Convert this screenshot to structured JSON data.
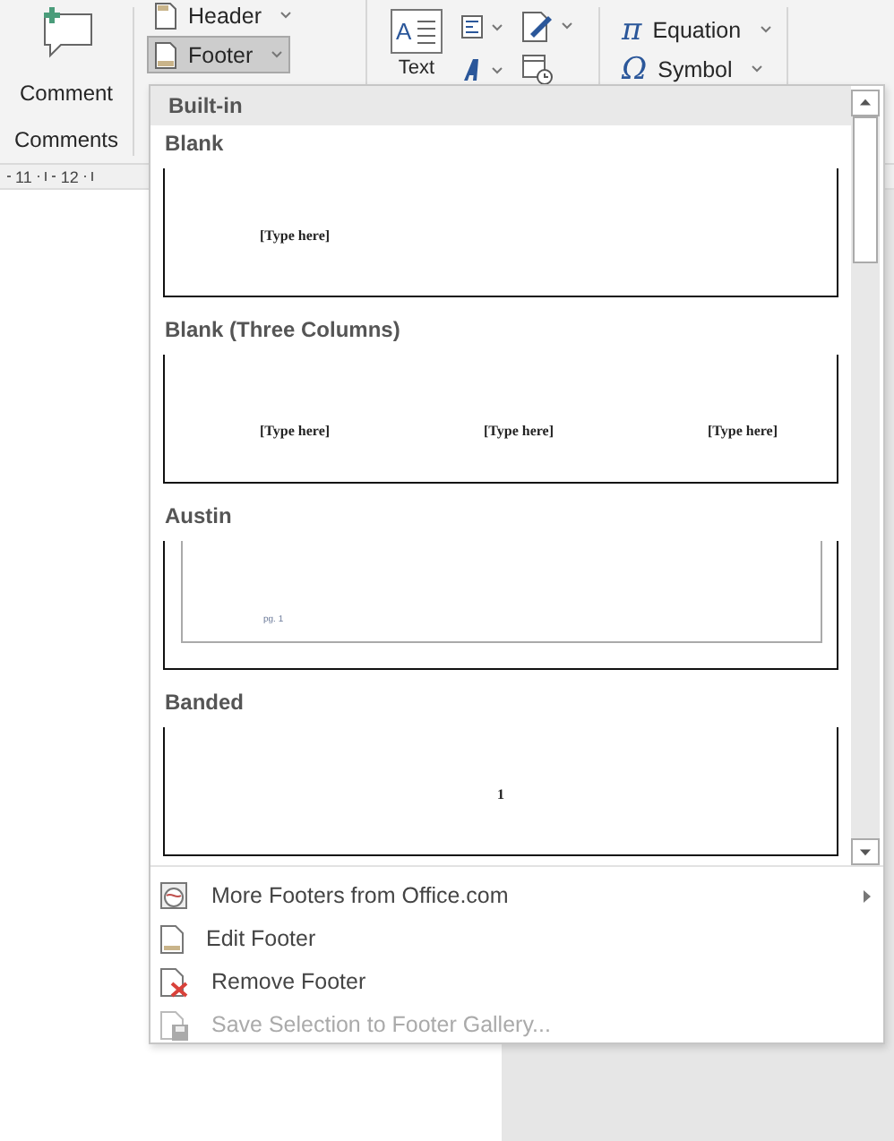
{
  "ribbon": {
    "comment_button": "Comment",
    "comments_group_label": "Comments",
    "header_footer": [
      {
        "label": "Header",
        "selected": false
      },
      {
        "label": "Footer",
        "selected": true
      }
    ],
    "text_button": "Text",
    "text_box_glyph": "A",
    "symbols": [
      {
        "symbol": "π",
        "label": "Equation"
      },
      {
        "symbol": "Ω",
        "label": "Symbol"
      }
    ]
  },
  "ruler": {
    "numbers": [
      "11",
      "12"
    ]
  },
  "footer_menu": {
    "section": "Built-in",
    "gallery": [
      {
        "title": "Blank",
        "kind": "blank",
        "texts": [
          "[Type here]"
        ]
      },
      {
        "title": "Blank (Three Columns)",
        "kind": "columns",
        "texts": [
          "[Type here]",
          "[Type here]",
          "[Type here]"
        ]
      },
      {
        "title": "Austin",
        "kind": "austin",
        "texts": [
          "pg. 1"
        ]
      },
      {
        "title": "Banded",
        "kind": "banded",
        "texts": [
          "1"
        ]
      }
    ],
    "items": [
      {
        "label": "More Footers from Office.com",
        "submenu": true,
        "disabled": false
      },
      {
        "label": "Edit Footer",
        "submenu": false,
        "disabled": false
      },
      {
        "label": "Remove Footer",
        "submenu": false,
        "disabled": false
      },
      {
        "label": "Save Selection to Footer Gallery...",
        "submenu": false,
        "disabled": true
      }
    ]
  }
}
